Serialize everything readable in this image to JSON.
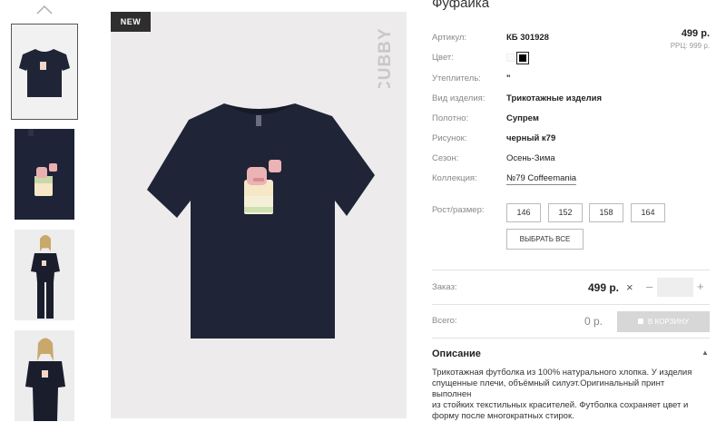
{
  "gallery": {
    "thumbnails": [
      {
        "name": "thumb-tshirt-front",
        "active": true
      },
      {
        "name": "thumb-print-closeup",
        "active": false
      },
      {
        "name": "thumb-model-full",
        "active": false
      },
      {
        "name": "thumb-model-half",
        "active": false
      }
    ]
  },
  "main_image": {
    "badge": "NEW",
    "brand_text": "CUBBY"
  },
  "product": {
    "title": "Фуфайка",
    "price": "499 р.",
    "rrp": "РРЦ: 999 р.",
    "attributes": [
      {
        "label": "Артикул:",
        "value": "КБ 301928",
        "style": "bold"
      },
      {
        "label": "Цвет:",
        "value": "",
        "style": "swatches"
      },
      {
        "label": "Утеплитель:",
        "value": "\"",
        "style": "bold"
      },
      {
        "label": "Вид изделия:",
        "value": "Трикотажные изделия",
        "style": "bold"
      },
      {
        "label": "Полотно:",
        "value": "Супрем",
        "style": "bold"
      },
      {
        "label": "Рисунок:",
        "value": "черный к79",
        "style": "bold"
      },
      {
        "label": "Сезон:",
        "value": "Осень-Зима",
        "style": "normal"
      },
      {
        "label": "Коллекция:",
        "value": "№79 Coffeemania",
        "style": "link"
      }
    ],
    "colors": [
      "#fafafa",
      "#000000"
    ],
    "size_label": "Рост/размер:",
    "sizes": [
      "146",
      "152",
      "158",
      "164"
    ],
    "select_all": "ВЫБРАТЬ ВСЕ"
  },
  "order": {
    "label": "Заказ:",
    "price": "499 р.",
    "times": "×",
    "minus": "–",
    "plus": "+",
    "quantity": ""
  },
  "total": {
    "label": "Всего:",
    "value": "0 р.",
    "cart_button": "В КОРЗИНУ"
  },
  "description": {
    "heading": "Описание",
    "caret": "▲",
    "lines": [
      "Трикотажная футболка из 100% натурального хлопка. У изделия",
      "спущенные плечи, объёмный силуэт.Оригинальный принт выполнен",
      "из стойких текстильных красителей. Футболка сохраняет цвет и",
      "форму после многократных стирок."
    ]
  }
}
